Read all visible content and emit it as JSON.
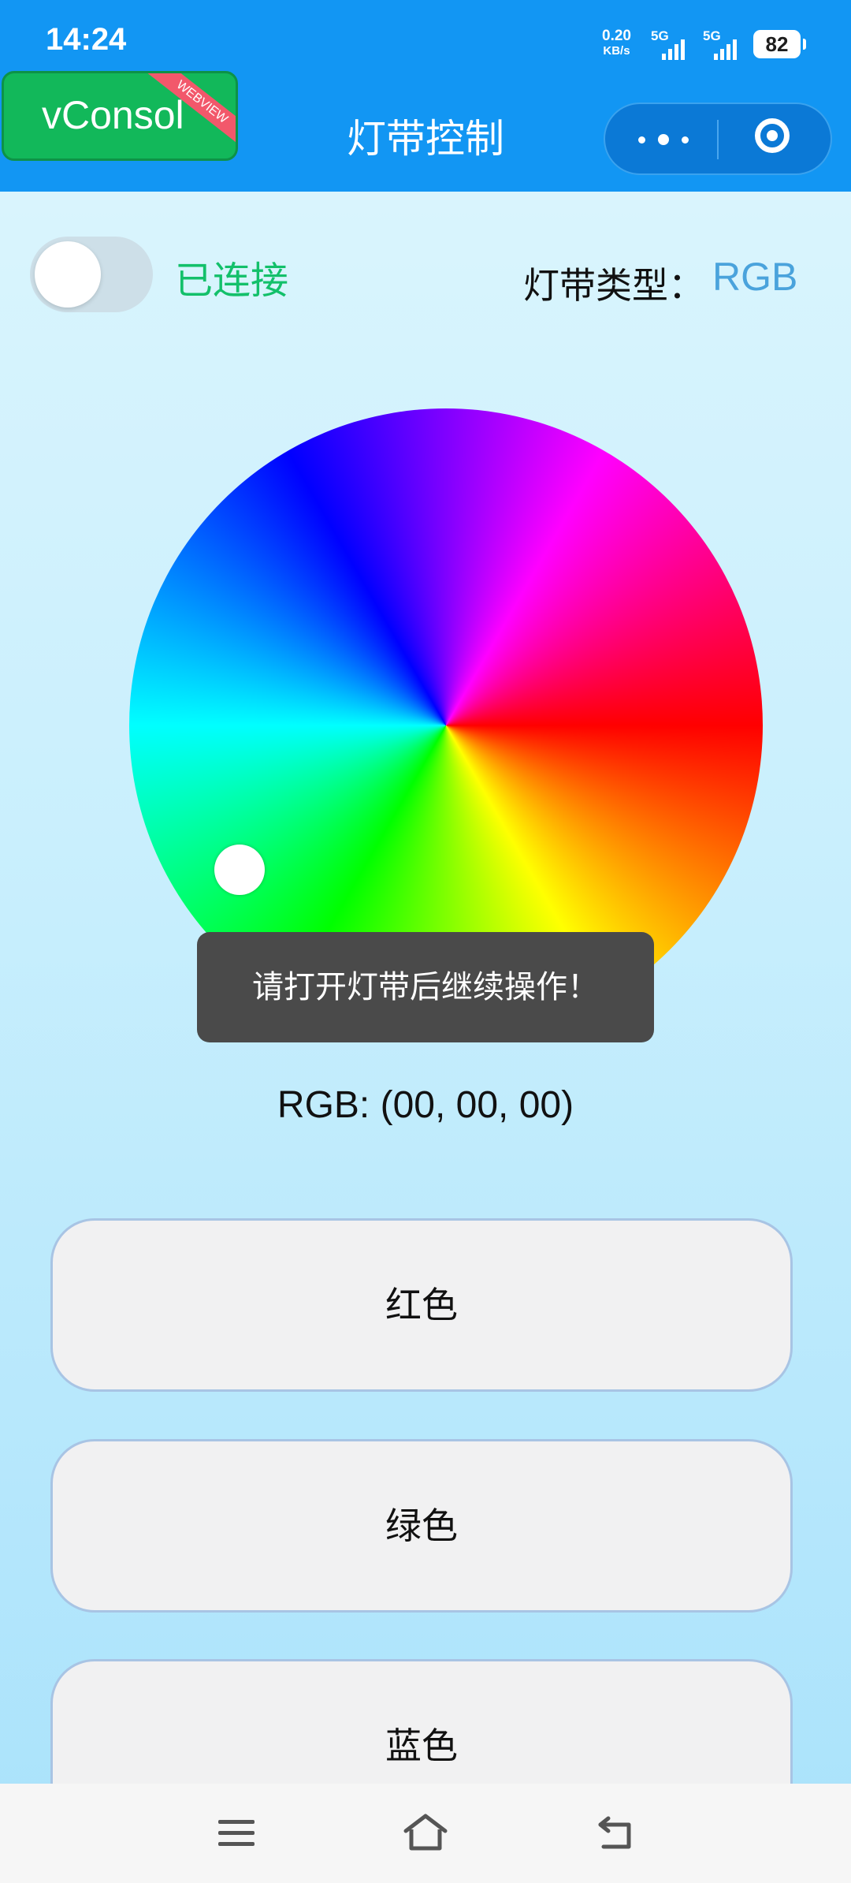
{
  "status_bar": {
    "time": "14:24",
    "net_speed_value": "0.20",
    "net_speed_unit": "KB/s",
    "signal_1_label": "5G",
    "signal_2_label": "5G",
    "battery": "82"
  },
  "nav": {
    "vconsole_label": "vConsol",
    "vconsole_ribbon": "WEBVIEW",
    "title": "灯带控制"
  },
  "connection": {
    "toggle_on": false,
    "status_text": "已连接",
    "strip_type_label": "灯带类型：",
    "strip_type_value": "RGB"
  },
  "toast": {
    "message": "请打开灯带后继续操作！"
  },
  "rgb_readout": "RGB: (00, 00, 00)",
  "buttons": {
    "red_label": "红色",
    "green_label": "绿色",
    "blue_label": "蓝色"
  },
  "colors": {
    "header_blue": "#1296f3",
    "connected_green": "#13c06a",
    "type_value_blue": "#4aa3dc",
    "toast_bg": "#4a4a4a"
  },
  "icons": {
    "menu": "menu-icon",
    "home": "home-icon",
    "back": "back-icon",
    "more": "more-dots-icon",
    "close": "target-close-icon"
  }
}
